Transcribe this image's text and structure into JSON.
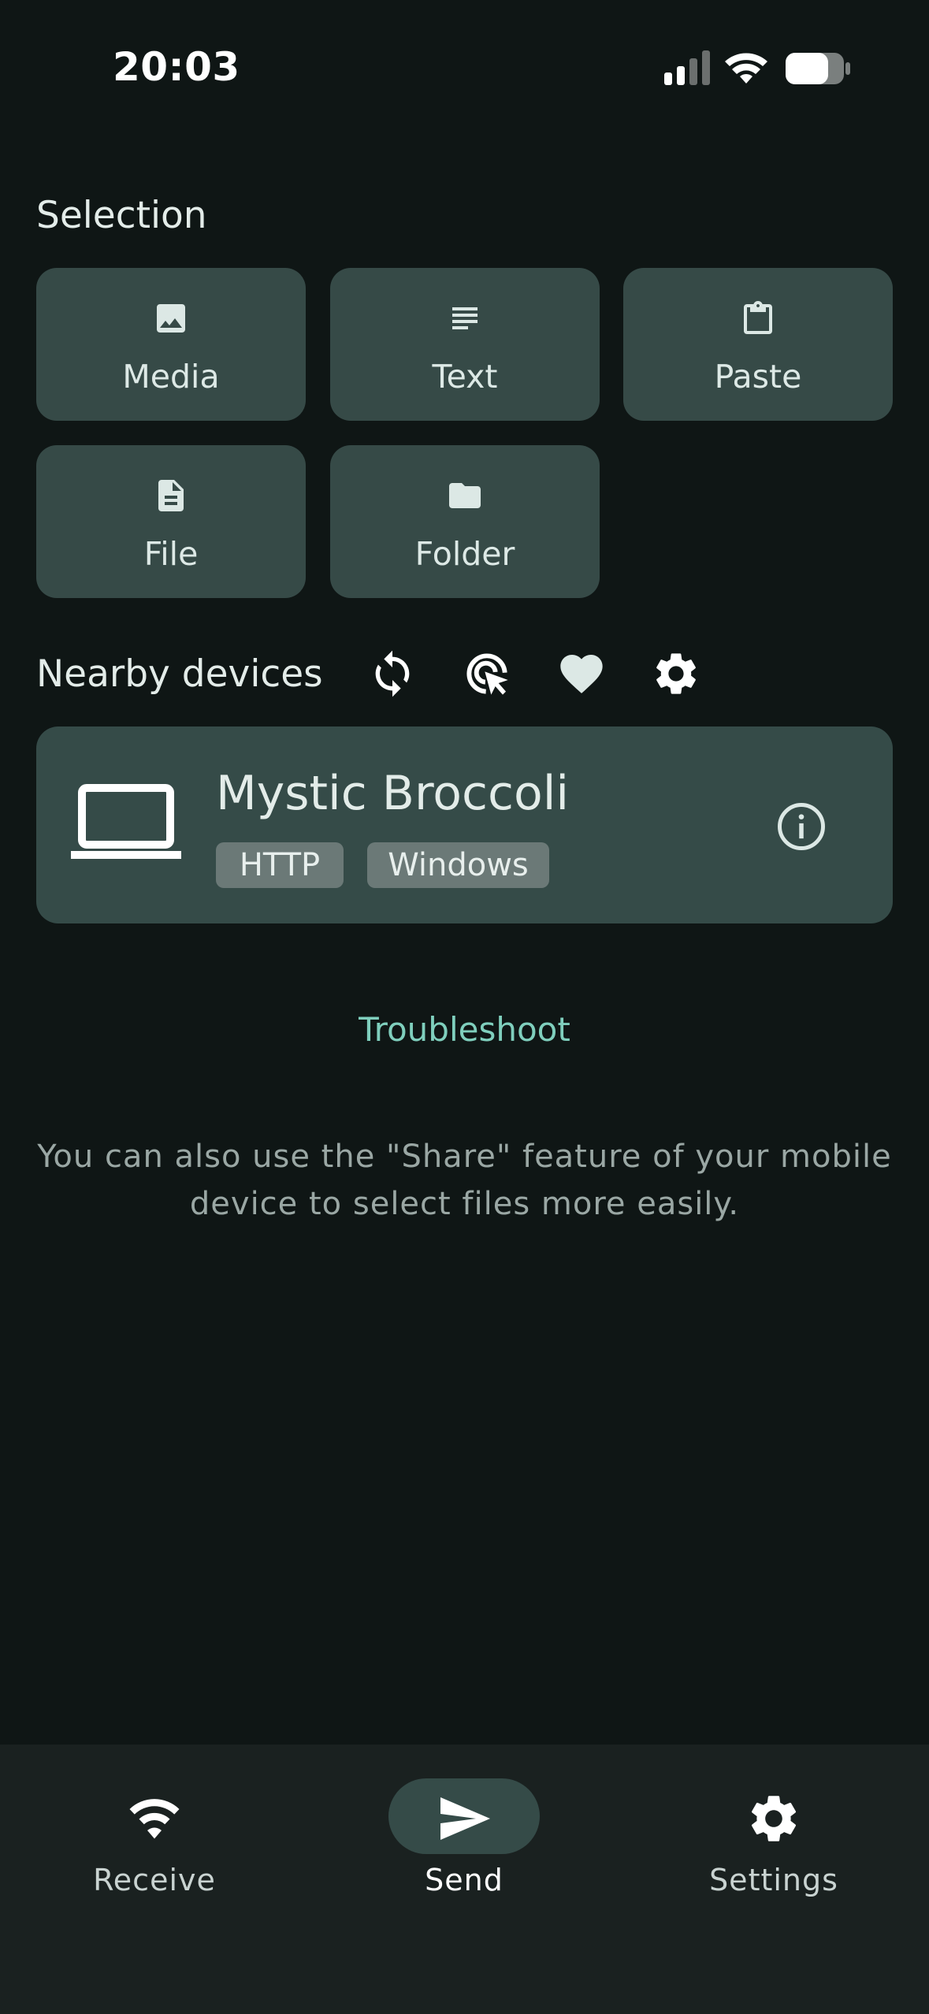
{
  "status_bar": {
    "time": "20:03"
  },
  "selection": {
    "title": "Selection",
    "tiles": [
      {
        "label": "Media",
        "icon": "image-icon"
      },
      {
        "label": "Text",
        "icon": "text-lines-icon"
      },
      {
        "label": "Paste",
        "icon": "clipboard-icon"
      },
      {
        "label": "File",
        "icon": "file-icon"
      },
      {
        "label": "Folder",
        "icon": "folder-icon"
      }
    ]
  },
  "nearby": {
    "title": "Nearby devices",
    "header_icons": [
      "refresh-icon",
      "scan-cursor-icon",
      "favorite-heart-icon",
      "settings-gear-icon"
    ],
    "devices": [
      {
        "name": "Mystic Broccoli",
        "icon": "laptop-icon",
        "tags": [
          "HTTP",
          "Windows"
        ]
      }
    ]
  },
  "troubleshoot_label": "Troubleshoot",
  "hint_line1": "You can also use the \"Share\" feature of your mobile",
  "hint_line2": "device to select files more easily.",
  "bottom_nav": {
    "items": [
      {
        "label": "Receive",
        "icon": "wifi-icon",
        "active": false
      },
      {
        "label": "Send",
        "icon": "send-icon",
        "active": true
      },
      {
        "label": "Settings",
        "icon": "gear-icon",
        "active": false
      }
    ]
  },
  "colors": {
    "background": "#0f1615",
    "tile": "#364a47",
    "accent": "#7fcfbd",
    "nav_background": "#1a2120"
  }
}
